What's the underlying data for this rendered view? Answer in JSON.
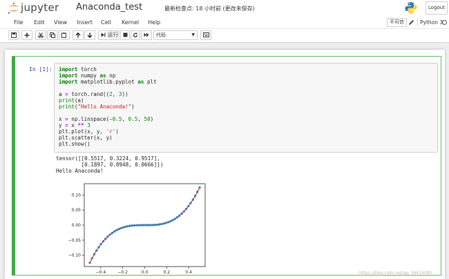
{
  "header": {
    "logo_text": "jupyter",
    "notebook_name": "Anaconda_test",
    "checkpoint": "最新检查点: 18 小时前   (更改未保存)",
    "logout_label": "Logout"
  },
  "menubar": {
    "items": [
      "File",
      "Edit",
      "View",
      "Insert",
      "Cell",
      "Kernel",
      "Help"
    ],
    "trusted_label": "不可信",
    "kernel_name": "Python 3"
  },
  "toolbar": {
    "run_label": "运行",
    "cell_type": "代码"
  },
  "cell": {
    "prompt": "In  [1]:",
    "code_lines": [
      "import torch",
      "import numpy as np",
      "import matplotlib.pyplot as plt",
      "",
      "a = torch.rand((2, 3))",
      "print(a)",
      "print(\"Hello Anaconda!\")",
      "",
      "x = np.linspace(-0.5, 0.5, 50)",
      "y = x ** 3",
      "plt.plot(x, y, 'r')",
      "plt.scatter(x, y)",
      "plt.show()"
    ],
    "output_lines": [
      "tensor([[0.5517, 0.3224, 0.9517],",
      "        [0.1897, 0.8948, 0.0666]])",
      "Hello Anaconda!"
    ]
  },
  "chart_data": {
    "type": "line",
    "title": "",
    "xlabel": "",
    "ylabel": "",
    "xlim": [
      -0.55,
      0.55
    ],
    "ylim": [
      -0.1375,
      0.1375
    ],
    "xticks": [
      -0.4,
      -0.2,
      0.0,
      0.2,
      0.4
    ],
    "xtick_labels": [
      "−0.4",
      "−0.2",
      "0.0",
      "0.2",
      "0.4"
    ],
    "yticks": [
      -0.1,
      -0.05,
      0.0,
      0.05,
      0.1
    ],
    "ytick_labels": [
      "−0.10",
      "−0.05",
      "0.00",
      "0.05",
      "0.10"
    ],
    "grid": false,
    "line_color": "#ff0000",
    "marker_color": "#1f77b4",
    "series": [
      {
        "x": [
          -0.5,
          -0.4796,
          -0.4592,
          -0.4388,
          -0.4184,
          -0.398,
          -0.3776,
          -0.3571,
          -0.3367,
          -0.3163,
          -0.2959,
          -0.2755,
          -0.2551,
          -0.2347,
          -0.2143,
          -0.1939,
          -0.1735,
          -0.1531,
          -0.1327,
          -0.1122,
          -0.0918,
          -0.0714,
          -0.051,
          -0.0306,
          -0.0102,
          0.0102,
          0.0306,
          0.051,
          0.0714,
          0.0918,
          0.1122,
          0.1327,
          0.1531,
          0.1735,
          0.1939,
          0.2143,
          0.2347,
          0.2551,
          0.2755,
          0.2959,
          0.3163,
          0.3367,
          0.3571,
          0.3776,
          0.398,
          0.4184,
          0.4388,
          0.4592,
          0.4796,
          0.5
        ],
        "y": [
          -0.125,
          -0.1103,
          -0.0968,
          -0.0845,
          -0.0732,
          -0.0631,
          -0.0538,
          -0.0455,
          -0.0382,
          -0.0316,
          -0.0259,
          -0.0209,
          -0.0166,
          -0.0129,
          -0.0098,
          -0.0073,
          -0.0052,
          -0.0036,
          -0.0023,
          -0.0014,
          -0.0008,
          -0.0004,
          -0.0001,
          0.0,
          0.0,
          0.0,
          0.0,
          0.0001,
          0.0004,
          0.0008,
          0.0014,
          0.0023,
          0.0036,
          0.0052,
          0.0073,
          0.0098,
          0.0129,
          0.0166,
          0.0209,
          0.0259,
          0.0316,
          0.0382,
          0.0455,
          0.0538,
          0.0631,
          0.0732,
          0.0845,
          0.0968,
          0.1103,
          0.125
        ]
      }
    ]
  },
  "watermark": "https://blog.csdn.net/qq_36414085"
}
